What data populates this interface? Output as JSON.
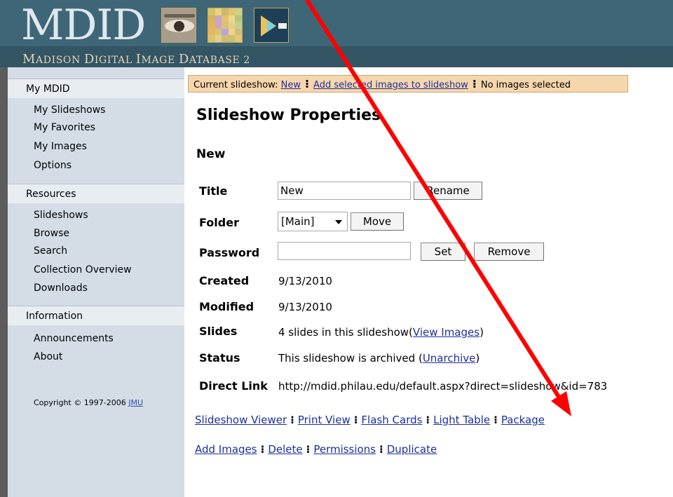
{
  "header": {
    "logo_text": "MDID",
    "tagline_parts": [
      "M",
      "ADISON ",
      "D",
      "IGITAL ",
      "I",
      "MAGE ",
      "D",
      "ATABASE 2"
    ]
  },
  "sidebar": {
    "sections": [
      {
        "heading": "My MDID",
        "items": [
          "My Slideshows",
          "My Favorites",
          "My Images",
          "Options"
        ]
      },
      {
        "heading": "Resources",
        "items": [
          "Slideshows",
          "Browse",
          "Search",
          "Collection Overview",
          "Downloads"
        ]
      },
      {
        "heading": "Information",
        "items": [
          "Announcements",
          "About"
        ]
      }
    ],
    "copyright_text": "Copyright © 1997-2006 ",
    "copyright_link": "JMU"
  },
  "current_bar": {
    "label": "Current slideshow: ",
    "slideshow_link": "New",
    "add_link": "Add selected images to slideshow",
    "status": "No images selected",
    "separator": "⁝"
  },
  "main": {
    "page_title": "Slideshow Properties",
    "slideshow_name": "New",
    "title_label": "Title",
    "title_value": "New",
    "rename_button": "Rename",
    "folder_label": "Folder",
    "folder_value": "[Main]",
    "move_button": "Move",
    "password_label": "Password",
    "password_value": "",
    "set_button": "Set",
    "remove_button": "Remove",
    "created_label": "Created",
    "created_value": "9/13/2010",
    "modified_label": "Modified",
    "modified_value": "9/13/2010",
    "slides_label": "Slides",
    "slides_text": "4 slides in this slideshow(",
    "slides_link": "View Images",
    "slides_close": ")",
    "status_label": "Status",
    "status_text": "This slideshow is archived (",
    "status_link": "Unarchive",
    "status_close": ")",
    "direct_label": "Direct Link",
    "direct_value": "http://mdid.philau.edu/default.aspx?direct=slideshow&id=783"
  },
  "action_links_1": [
    "Slideshow Viewer",
    "Print View",
    "Flash Cards",
    "Light Table",
    "Package"
  ],
  "action_links_2": [
    "Add Images",
    "Delete",
    "Permissions",
    "Duplicate"
  ],
  "annotation": {
    "arrow_color": "#ff0000"
  },
  "mosaic_colors": [
    "#d8c36a",
    "#e9d47a",
    "#cbb86d",
    "#e3c46a",
    "#c9d38a",
    "#d8b45a",
    "#c7a4d6",
    "#e5c26b",
    "#f0d88a",
    "#b8c47a",
    "#e0b65e",
    "#cfa3c2",
    "#d9c27c",
    "#e8cf83",
    "#c2cf92",
    "#e7b65c",
    "#d6c46f",
    "#b9a5d9",
    "#efd38b",
    "#d1bf79",
    "#dcc26e",
    "#e6d18a",
    "#cfbd76",
    "#c9c16d",
    "#e2c774"
  ]
}
